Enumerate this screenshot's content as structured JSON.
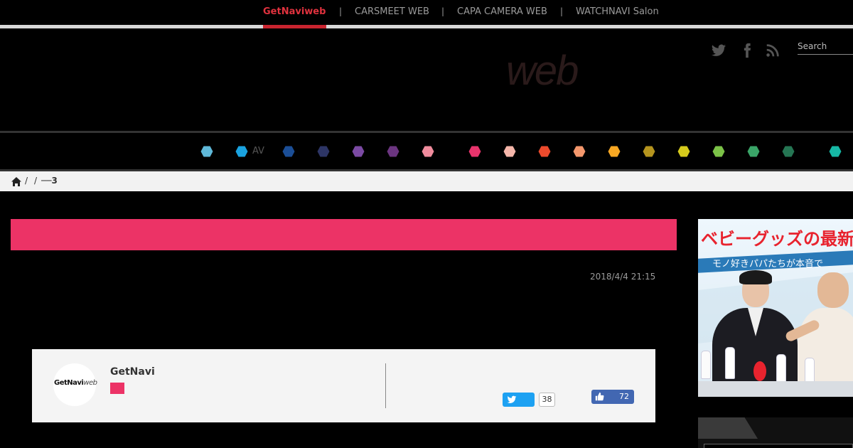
{
  "topnav": {
    "items": [
      "GetNaviweb",
      "CARSMEET WEB",
      "CAPA CAMERA WEB",
      "WATCHNAVI Salon"
    ],
    "separator": "|"
  },
  "header": {
    "logo_text": "web",
    "search_placeholder": "Search",
    "social_icons": [
      "twitter-icon",
      "facebook-icon",
      "rss-icon"
    ]
  },
  "categories": {
    "label_av": "AV",
    "colors": [
      "#5fb8d8",
      "#1aa3e0",
      "#1b4e96",
      "#2d3565",
      "#7b4aa3",
      "#6b3580",
      "#f08c9d",
      "#e8346c",
      "#f5b6aa",
      "#ec4a2c",
      "#f4976c",
      "#f9a823",
      "#b5941e",
      "#d6cb1c",
      "#7bc247",
      "#3aa568",
      "#257553",
      "#16b8a5"
    ]
  },
  "breadcrumb": {
    "sep1": "/",
    "sep2": "/",
    "current": "──3"
  },
  "article": {
    "date": "2018/4/4 21:15",
    "accent_color": "#ec3366"
  },
  "author": {
    "logo_bold": "GetNavi",
    "logo_italic": "web",
    "name": "GetNavi",
    "twitter_count": "38",
    "like_count": "72"
  },
  "sidebar": {
    "ad_title": "ベビーグッズの最新",
    "ad_subtitle": "モノ好きパパたちが本音で"
  }
}
